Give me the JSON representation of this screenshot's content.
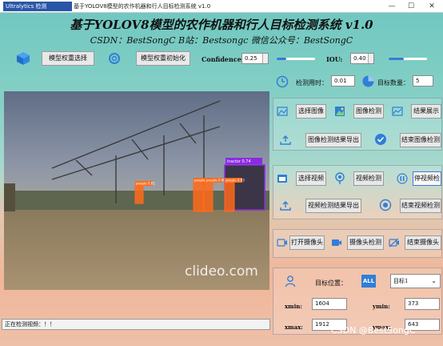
{
  "window": {
    "logo_text": "Ultralytics 检测",
    "title": "基于YOLOV8模型的农作机器和行人目标检测系统 v1.0",
    "minimize": "—",
    "maximize": "☐",
    "close": "✕"
  },
  "header": {
    "title": "基于YOLOV8模型的农作机器和行人目标检测系统 v1.0",
    "subtitle": "CSDN：BestSongC   B站：Bestsongc   微信公众号：BestSongC"
  },
  "toolbar": {
    "select_weights": "模型权重选择",
    "init_weights": "模型权重初始化",
    "confidence_label": "Confidence:",
    "confidence_value": "0.25",
    "confidence_level": 0.25,
    "iou_label": "IOU:",
    "iou_value": "0.40",
    "iou_level": 0.4
  },
  "stats": {
    "time_label": "检测用时：",
    "time_value": "0.01",
    "count_label": "目标数量：",
    "count_value": "5"
  },
  "image_section": {
    "select_image": "选择图像",
    "detect_image": "图像检测",
    "show_result": "结果展示",
    "export_image": "图像检测结果导出",
    "stop_image": "结束图像检测"
  },
  "video_section": {
    "select_video": "选择视频",
    "detect_video": "视频检测",
    "pause_video": "停视频检",
    "export_video": "视频检测结果导出",
    "stop_video": "结束视频检测"
  },
  "camera_section": {
    "open_camera": "打开摄像头",
    "detect_camera": "摄像头检测",
    "stop_camera": "结束摄像头"
  },
  "target": {
    "position_label": "目标位置：",
    "all_badge": "ALL",
    "selected": "目标1",
    "xmin_label": "xmin:",
    "xmin_value": "1604",
    "ymin_label": "ymin:",
    "ymin_value": "373",
    "xmax_label": "xmax:",
    "xmax_value": "1912",
    "ymax_label": "ymax:",
    "ymax_value": "643"
  },
  "preview": {
    "watermark": "clideo.com",
    "boxes": [
      {
        "label": "people 0.81",
        "color": "#ff6a1a"
      },
      {
        "label": "people 0.85",
        "color": "#ff6a1a"
      },
      {
        "label": "people 0.80",
        "color": "#ff6a1a"
      },
      {
        "label": "people 0.83",
        "color": "#ff6a1a"
      },
      {
        "label": "tractor 0.74",
        "color": "#8a2be2"
      }
    ]
  },
  "status": {
    "text": "正在检测视频：！！"
  },
  "credit": "CSDN @BestSongC",
  "colors": {
    "accent": "#3c78d8",
    "icon_blue": "#2f7fd8",
    "detect_box": "#ff6a1a",
    "tractor_box": "#8a2be2"
  }
}
